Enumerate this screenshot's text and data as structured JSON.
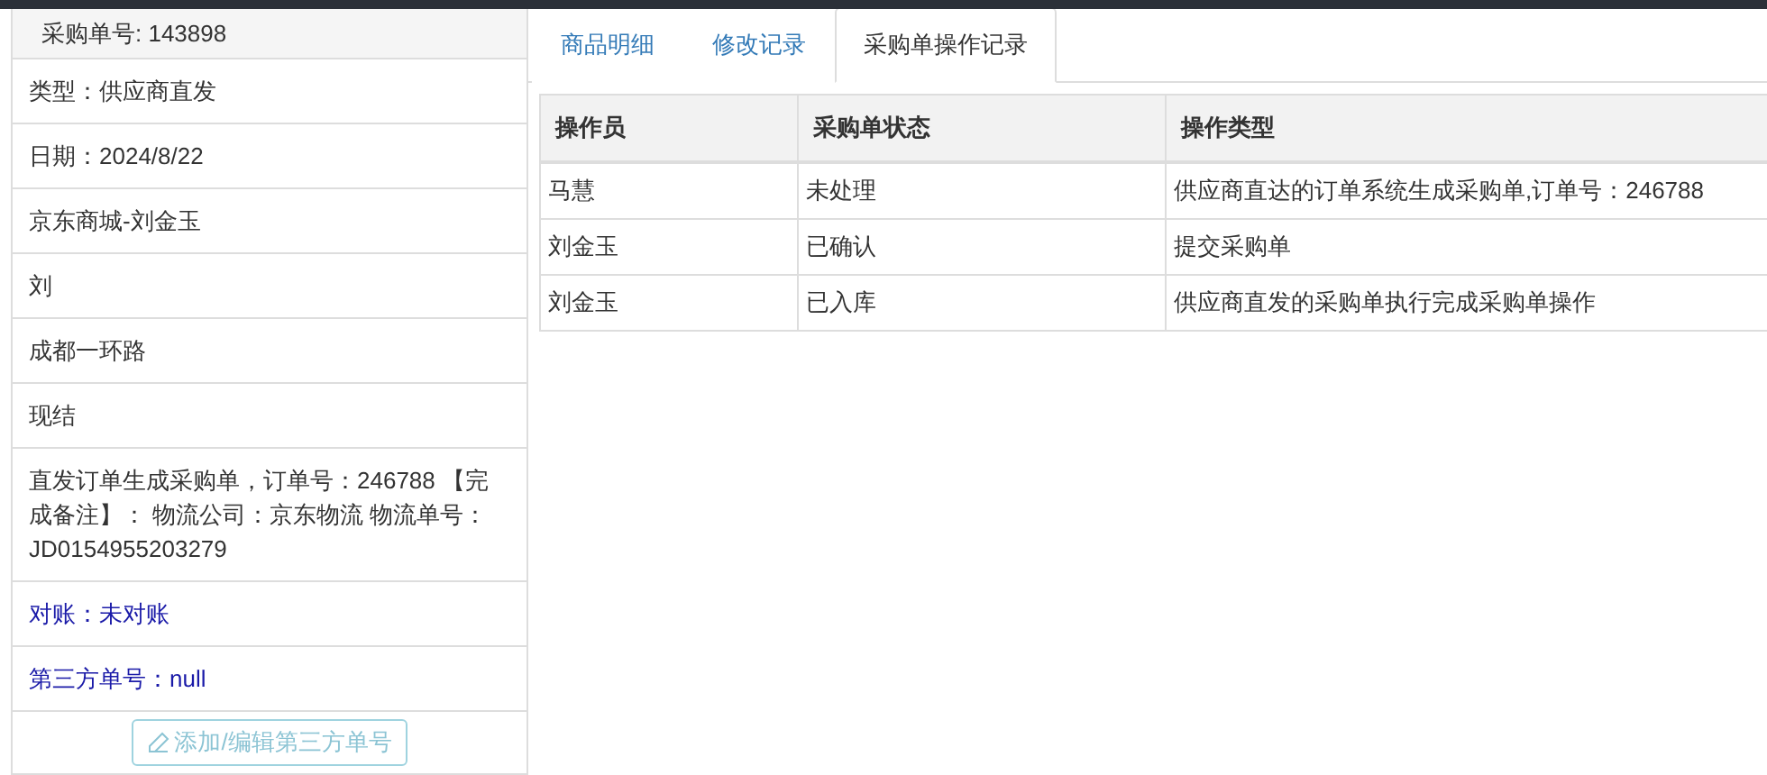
{
  "order_panel": {
    "title": "采购单号: 143898",
    "items": [
      {
        "text": "类型：供应商直发",
        "kind": "plain"
      },
      {
        "text": "日期：2024/8/22",
        "kind": "plain"
      },
      {
        "text": "京东商城-刘金玉",
        "kind": "plain"
      },
      {
        "text": "刘",
        "kind": "plain"
      },
      {
        "text": "成都一环路",
        "kind": "plain"
      },
      {
        "text": "现结",
        "kind": "plain"
      },
      {
        "text": "直发订单生成采购单，订单号：246788 【完成备注】： 物流公司：京东物流 物流单号：JD0154955203279",
        "kind": "plain"
      },
      {
        "text": "对账：未对账",
        "kind": "highlight"
      },
      {
        "text": "第三方单号：null",
        "kind": "highlight"
      }
    ],
    "button": "添加/编辑第三方单号"
  },
  "tabs": [
    {
      "label": "商品明细",
      "selected": false
    },
    {
      "label": "修改记录",
      "selected": false
    },
    {
      "label": "采购单操作记录",
      "selected": true
    }
  ],
  "table": {
    "columns": [
      "操作员",
      "采购单状态",
      "操作类型"
    ],
    "rows": [
      [
        "马慧",
        "未处理",
        "供应商直达的订单系统生成采购单,订单号：246788"
      ],
      [
        "刘金玉",
        "已确认",
        "提交采购单"
      ],
      [
        "刘金玉",
        "已入库",
        "供应商直发的采购单执行完成采购单操作"
      ]
    ]
  }
}
